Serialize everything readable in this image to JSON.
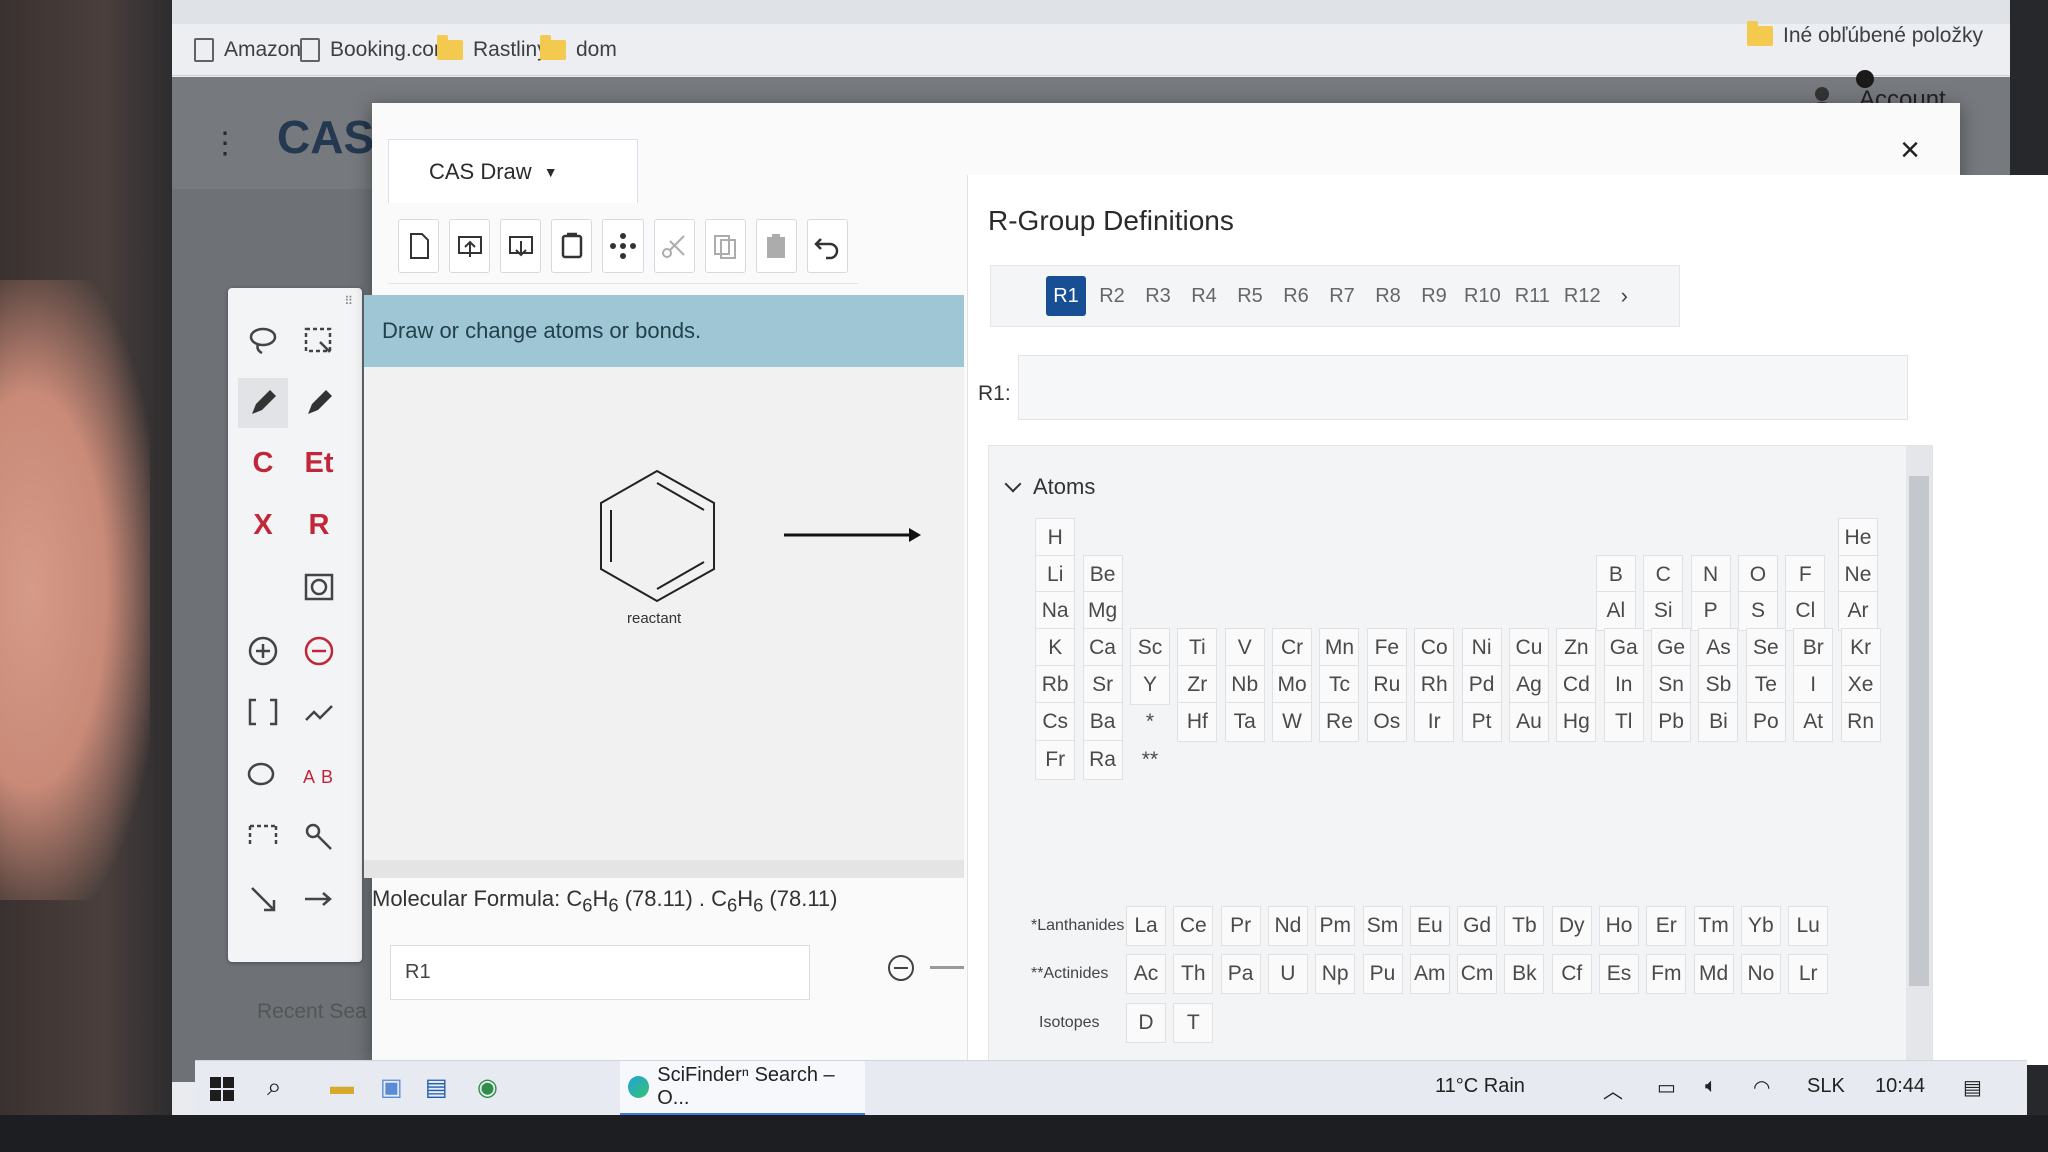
{
  "browser": {
    "bookmarks": [
      "Amazon",
      "Booking.com",
      "Rastliny",
      "dom"
    ],
    "other_bookmarks": "Iné obľúbené položky"
  },
  "app": {
    "logo": "CAS",
    "account_label": "Account",
    "recent_label": "Recent Sea"
  },
  "toolbar": {
    "carbon": "C",
    "ethyl": "Et",
    "halogen": "X",
    "rgroup": "R"
  },
  "dialog": {
    "product": "CAS Draw",
    "close": "×",
    "hint": "Draw or change atoms or bonds.",
    "structure_label": "reactant",
    "molecular_formula": {
      "prefix": "Molecular Formula: ",
      "c": "C",
      "c_sub": "6",
      "h": "H",
      "h_sub": "6",
      "mass": " (78.11) . ",
      "c2": "C",
      "c2_sub": "6",
      "h2": "H",
      "h2_sub": "6",
      "mass2": " (78.11)"
    },
    "name_box": "R1"
  },
  "rgroup": {
    "title": "R-Group Definitions",
    "close": "×",
    "tabs": [
      "R1",
      "R2",
      "R3",
      "R4",
      "R5",
      "R6",
      "R7",
      "R8",
      "R9",
      "R10",
      "R11",
      "R12"
    ],
    "active_tab": "R1",
    "next": "›",
    "input_label": "R1:",
    "section_title": "Atoms",
    "lanthanides_label": "*Lanthanides",
    "actinides_label": "**Actinides",
    "isotopes_label": "Isotopes",
    "lanthanides": [
      "La",
      "Ce",
      "Pr",
      "Nd",
      "Pm",
      "Sm",
      "Eu",
      "Gd",
      "Tb",
      "Dy",
      "Ho",
      "Er",
      "Tm",
      "Yb",
      "Lu"
    ],
    "actinides": [
      "Ac",
      "Th",
      "Pa",
      "U",
      "Np",
      "Pu",
      "Am",
      "Cm",
      "Bk",
      "Cf",
      "Es",
      "Fm",
      "Md",
      "No",
      "Lr"
    ],
    "isotopes": [
      "D",
      "T"
    ]
  },
  "taskbar": {
    "app_title": "SciFinderⁿ Search – O...",
    "weather": "11°C  Rain",
    "language": "SLK",
    "time": "10:44"
  }
}
